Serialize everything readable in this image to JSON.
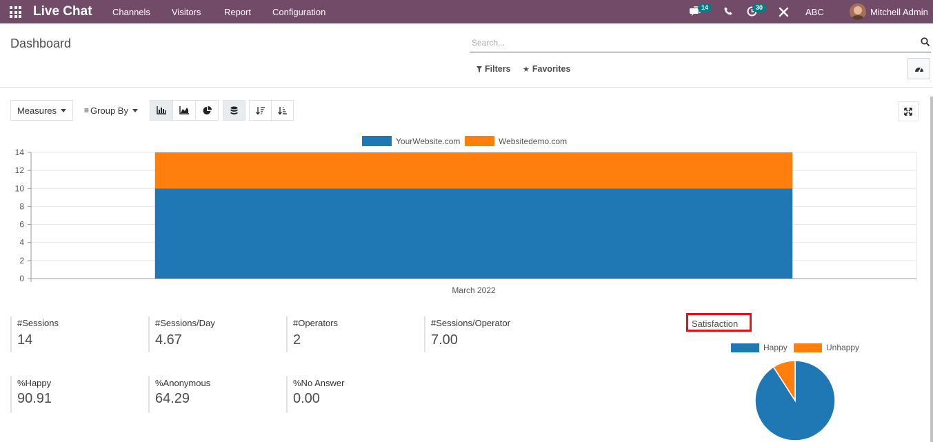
{
  "navbar": {
    "app_title": "Live Chat",
    "menu": [
      "Channels",
      "Visitors",
      "Report",
      "Configuration"
    ],
    "messages_count": "14",
    "activities_count": "30",
    "company": "ABC",
    "user_name": "Mitchell Admin",
    "bg_color": "#714b67"
  },
  "control_panel": {
    "breadcrumb": "Dashboard",
    "search_placeholder": "Search...",
    "filters_label": "Filters",
    "favorites_label": "Favorites"
  },
  "toolbar": {
    "measures_label": "Measures",
    "group_by_label": "Group By",
    "view_icons": [
      "bar-chart-icon",
      "line-chart-icon",
      "pie-chart-icon",
      "stacked-icon",
      "sort-descending-icon",
      "sort-ascending-icon"
    ]
  },
  "chart_data": {
    "type": "bar",
    "stacked": true,
    "categories": [
      "March 2022"
    ],
    "series": [
      {
        "name": "YourWebsite.com",
        "values": [
          10
        ],
        "color": "#1f77b4"
      },
      {
        "name": "Websitedemo.com",
        "values": [
          4
        ],
        "color": "#ff7f0e"
      }
    ],
    "y_ticks": [
      "0",
      "2",
      "4",
      "6",
      "8",
      "10",
      "12",
      "14"
    ],
    "ylim": [
      0,
      14
    ],
    "legend_position": "top-center",
    "grid": true
  },
  "kpis": [
    {
      "label": "#Sessions",
      "value": "14"
    },
    {
      "label": "#Sessions/Day",
      "value": "4.67"
    },
    {
      "label": "#Operators",
      "value": "2"
    },
    {
      "label": "#Sessions/Operator",
      "value": "7.00"
    },
    {
      "label": "%Happy",
      "value": "90.91"
    },
    {
      "label": "%Anonymous",
      "value": "64.29"
    },
    {
      "label": "%No Answer",
      "value": "0.00"
    }
  ],
  "satisfaction": {
    "title": "Satisfaction",
    "chart_data": {
      "type": "pie",
      "labels": [
        "Happy",
        "Unhappy"
      ],
      "values": [
        90.91,
        9.09
      ],
      "colors": [
        "#1f77b4",
        "#ff7f0e"
      ],
      "legend_position": "top-center"
    }
  }
}
